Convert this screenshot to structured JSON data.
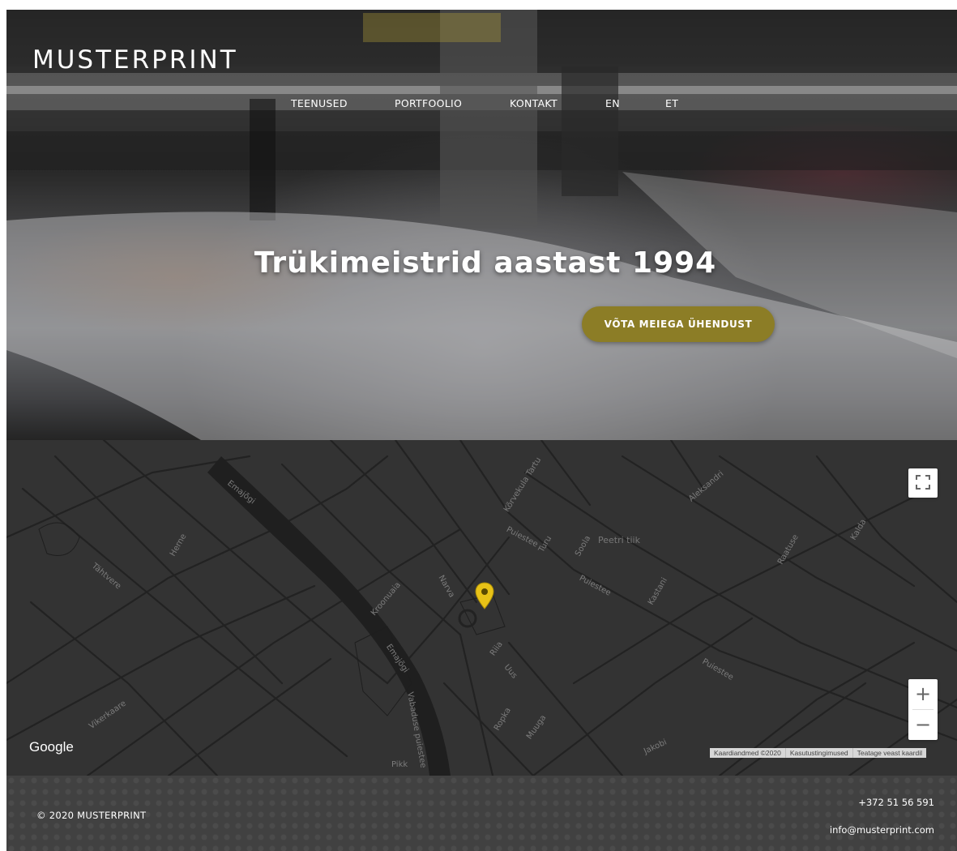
{
  "brand": {
    "logo_text": "MUSTERPRINT"
  },
  "nav": {
    "items": [
      {
        "label": "TEENUSED"
      },
      {
        "label": "PORTFOOLIO"
      },
      {
        "label": "KONTAKT"
      },
      {
        "label": "EN"
      },
      {
        "label": "ET"
      }
    ]
  },
  "hero": {
    "title": "Trükimeistrid aastast 1994",
    "cta_label": "VÕTA MEIEGA ÜHENDUST",
    "cta_color": "#8c7d26"
  },
  "map": {
    "streets": [
      "Emajõgi",
      "Emajõgi",
      "Kroonuaia",
      "Puiestee",
      "Puiestee",
      "Puiestee",
      "Peetri tiik",
      "Kõrvekula Tartu",
      "Vabaduse puiestee",
      "Riia",
      "Turu",
      "Raatuse",
      "Kastani",
      "Herne",
      "Tähtvere",
      "Vikerkaare",
      "Ropka",
      "Kalda",
      "Aleksandri",
      "Narva",
      "Jakobi",
      "Uus",
      "Pikk",
      "Muuga",
      "Soola",
      "Mäe"
    ],
    "marker_color": "#e8c217",
    "google_logo": "Google",
    "attribution": [
      "Kaardiandmed ©2020",
      "Kasutustingimused",
      "Teatage veast kaardil"
    ],
    "zoom_in": "+",
    "zoom_out": "−",
    "fullscreen_icon": "fullscreen-icon"
  },
  "footer": {
    "copyright": "© 2020 MUSTERPRINT",
    "phone": "+372 51 56 591",
    "email": "info@musterprint.com"
  }
}
